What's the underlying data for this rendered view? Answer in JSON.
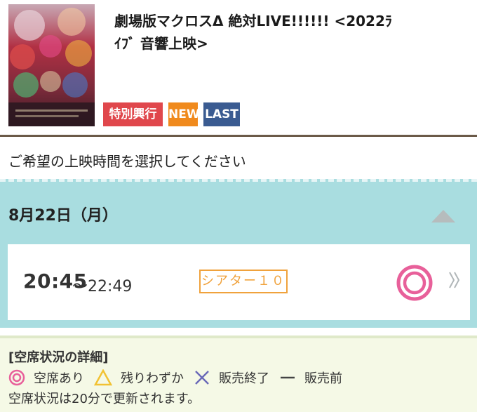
{
  "movie": {
    "title_line1": "劇場版マクロスΔ  絶対LIVE!!!!!!  <2022ﾗ",
    "title_line2": "ｲﾌﾞ 音響上映>",
    "badges": {
      "special": "特別興行",
      "new": "NEW",
      "last": "LAST"
    }
  },
  "instruction": "ご希望の上映時間を選択してください",
  "schedule": {
    "date": "8月22日（月）",
    "showings": [
      {
        "start": "20:45",
        "end": "～22:49",
        "screen": "シアター１０",
        "status": "circle-double-icon"
      }
    ]
  },
  "legend": {
    "title": "[空席状況の詳細]",
    "items": [
      {
        "icon": "double-circle-icon",
        "label": "空席あり"
      },
      {
        "icon": "triangle-icon",
        "label": "残りわずか"
      },
      {
        "icon": "cross-icon",
        "label": "販売終了"
      },
      {
        "icon": "dash-icon",
        "label": "販売前"
      }
    ],
    "note": "空席状況は20分で更新されます。"
  },
  "colors": {
    "special_badge": "#e0474c",
    "new_badge": "#f08a1d",
    "last_badge": "#3a5b91",
    "date_bg": "#a9dde0",
    "available_pink": "#e8609a",
    "screen_orange": "#f0a23c"
  }
}
